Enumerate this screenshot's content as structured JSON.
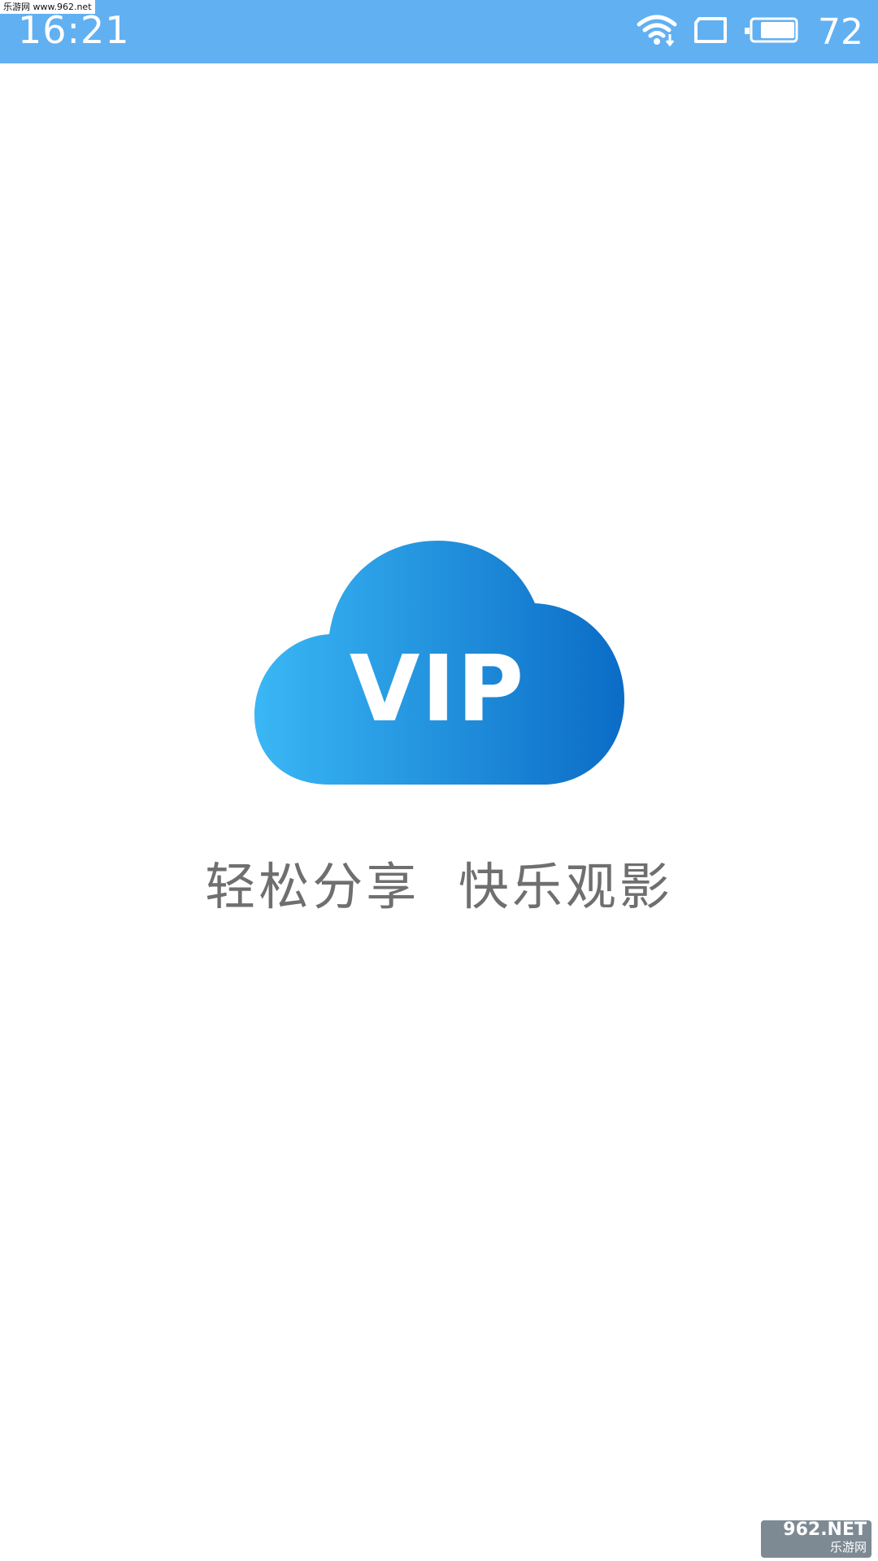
{
  "status_bar": {
    "time": "16:21",
    "battery_level": "72",
    "icons": [
      "wifi-icon",
      "screen-rotate-icon",
      "battery-icon"
    ],
    "background_color": "#61b0f2"
  },
  "splash": {
    "logo_text": "VIP",
    "slogan": "轻松分享  快乐观影",
    "logo_gradient": [
      "#3ab7f5",
      "#0b6cc6"
    ]
  },
  "watermarks": {
    "top_left": "乐游网 www.962.net",
    "bottom_right_brand": "962.NET",
    "bottom_right_sub": "乐游网"
  }
}
